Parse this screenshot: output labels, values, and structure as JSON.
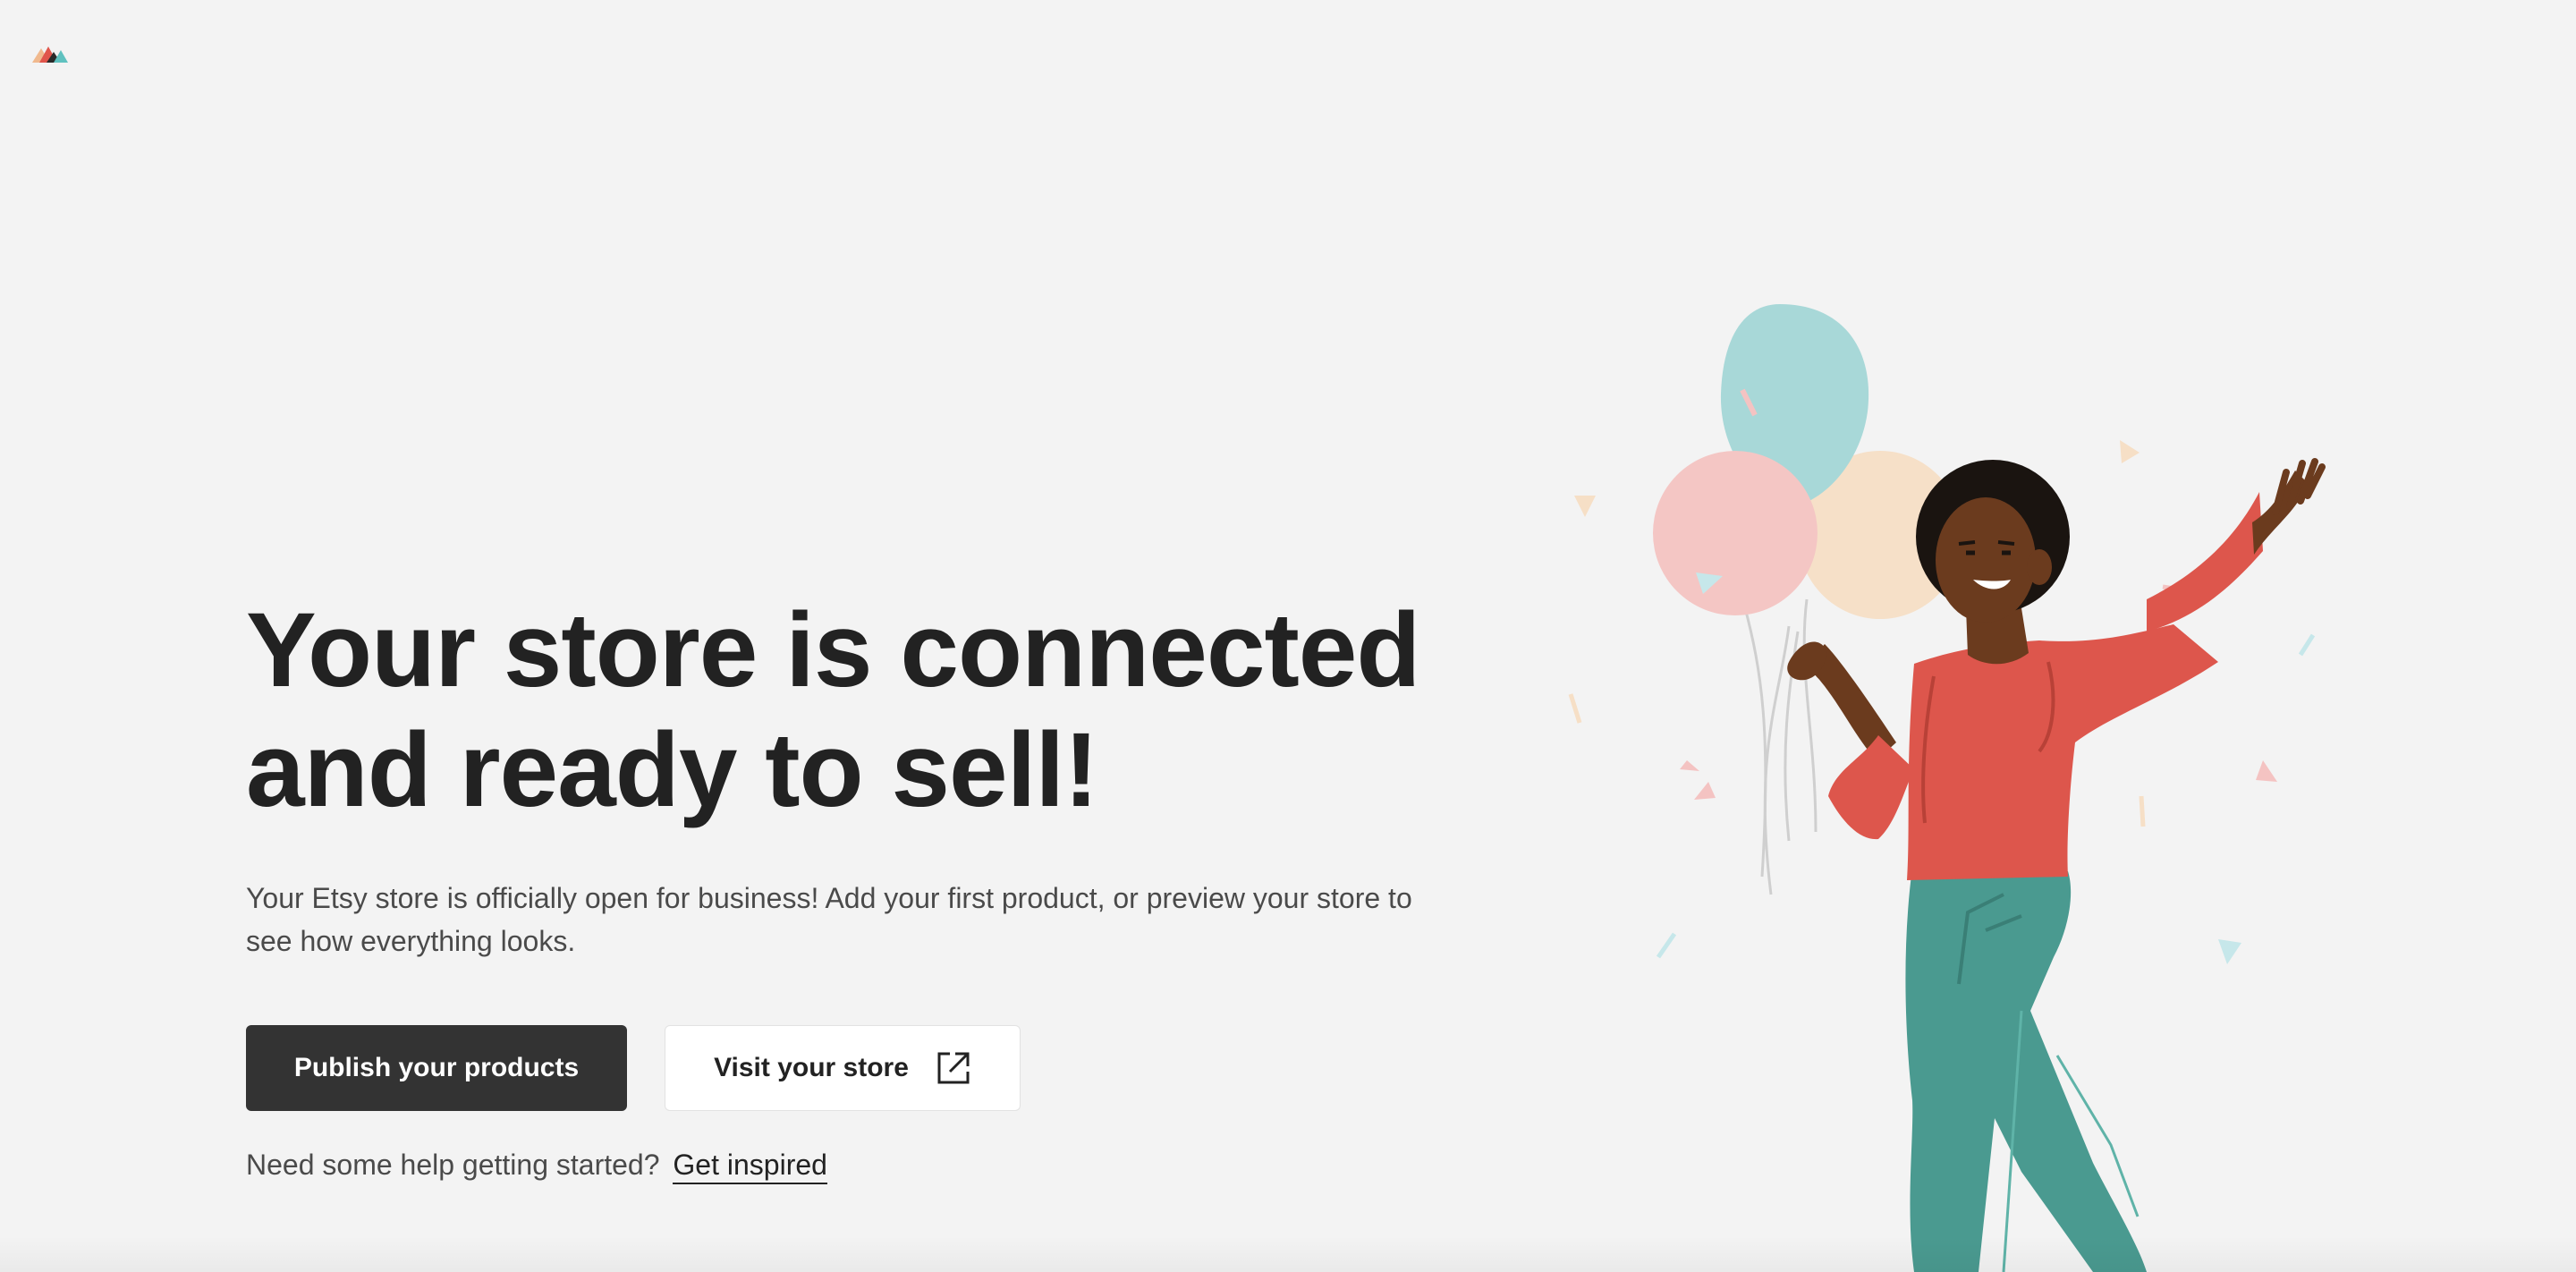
{
  "brand": {
    "logo_icon": "mountain-logo-icon",
    "colors": [
      "#f0b98e",
      "#e0554b",
      "#2a2a2a",
      "#5fc1bf"
    ]
  },
  "hero": {
    "headline_line1": "Your store is connected",
    "headline_line2": "and ready to sell!",
    "subtext": "Your Etsy store is officially open for business! Add your first product, or preview your store to see how everything looks."
  },
  "actions": {
    "primary_label": "Publish your products",
    "secondary_label": "Visit your store",
    "secondary_icon": "external-link-icon"
  },
  "help": {
    "text": "Need some help getting started?",
    "link_label": "Get inspired"
  },
  "illustration": {
    "subject": "woman-with-balloons-illustration",
    "balloon_colors": [
      "#a8d8d8",
      "#f4c6c4",
      "#f6e0c8"
    ],
    "shirt_color": "#dd564c",
    "pants_color": "#4a9a90"
  }
}
